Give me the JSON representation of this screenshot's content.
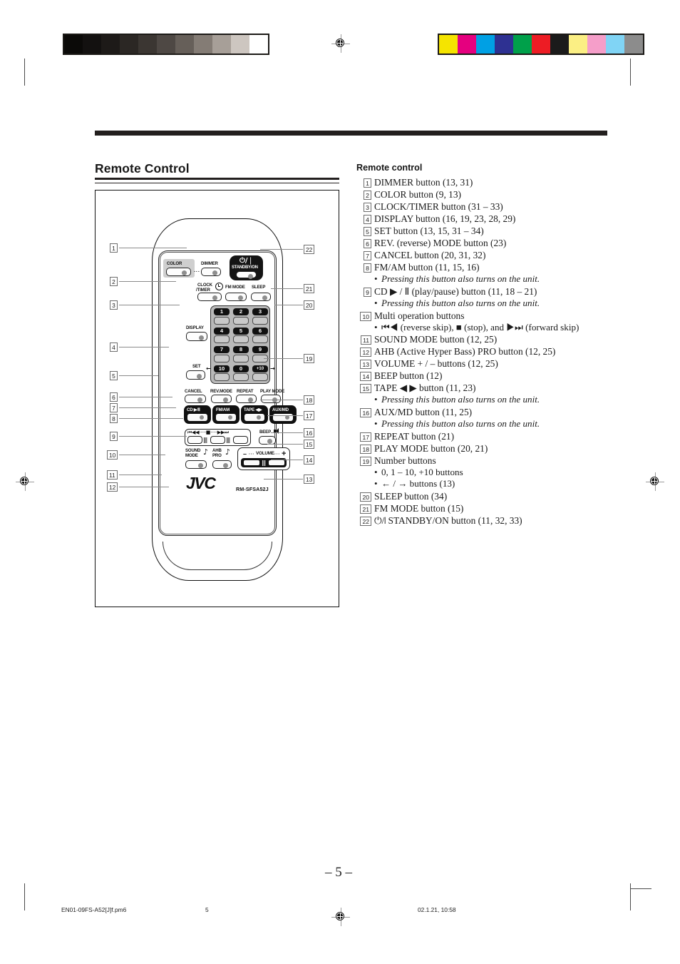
{
  "document": {
    "section_title": "Remote Control",
    "page_number": "– 5 –"
  },
  "list_header": "Remote control",
  "items": [
    {
      "n": "1",
      "text": "DIMMER button (13, 31)"
    },
    {
      "n": "2",
      "text": "COLOR button (9, 13)"
    },
    {
      "n": "3",
      "text": "CLOCK/TIMER button (31 – 33)"
    },
    {
      "n": "4",
      "text": "DISPLAY button (16, 19, 23, 28, 29)"
    },
    {
      "n": "5",
      "text": "SET button (13, 15, 31 – 34)"
    },
    {
      "n": "6",
      "text": "REV. (reverse) MODE button (23)"
    },
    {
      "n": "7",
      "text": "CANCEL button (20, 31, 32)"
    },
    {
      "n": "8",
      "text": "FM/AM button (11, 15, 16)",
      "notes": [
        {
          "style": "italic",
          "text": "Pressing this button also turns on the unit."
        }
      ]
    },
    {
      "n": "9",
      "text": "CD ▶ / Ⅱ (play/pause) button (11, 18 – 21)",
      "html": true,
      "notes": [
        {
          "style": "italic",
          "text": "Pressing this button also turns on the unit."
        }
      ]
    },
    {
      "n": "10",
      "text": "Multi operation buttons",
      "notes": [
        {
          "style": "normal",
          "text": "⏮◀ (reverse skip), ■ (stop), and ▶⏭ (forward skip)"
        }
      ]
    },
    {
      "n": "11",
      "text": "SOUND MODE button (12, 25)"
    },
    {
      "n": "12",
      "text": "AHB (Active Hyper Bass) PRO button (12, 25)"
    },
    {
      "n": "13",
      "text": "VOLUME + / – buttons (12, 25)"
    },
    {
      "n": "14",
      "text": "BEEP button (12)"
    },
    {
      "n": "15",
      "text": "TAPE ◀ ▶ button (11, 23)",
      "notes": [
        {
          "style": "italic",
          "text": "Pressing this button also turns on the unit."
        }
      ]
    },
    {
      "n": "16",
      "text": "AUX/MD button (11, 25)",
      "notes": [
        {
          "style": "italic",
          "text": "Pressing this button also turns on the unit."
        }
      ]
    },
    {
      "n": "17",
      "text": "REPEAT button (21)"
    },
    {
      "n": "18",
      "text": "PLAY MODE button (20, 21)"
    },
    {
      "n": "19",
      "text": "Number buttons",
      "notes": [
        {
          "style": "normal",
          "text": "0, 1 – 10, +10 buttons"
        },
        {
          "style": "normal",
          "text": "← / → buttons (13)"
        }
      ]
    },
    {
      "n": "20",
      "text": "SLEEP button (34)"
    },
    {
      "n": "21",
      "text": "FM MODE button (15)"
    },
    {
      "n": "22",
      "text": "⏻/❘ STANDBY/ON button (11, 32, 33)"
    }
  ],
  "remote": {
    "brand": "JVC",
    "model": "RM-SFSA52J",
    "buttons": {
      "color": "COLOR",
      "dimmer": "DIMMER",
      "clock_timer_l1": "CLOCK",
      "clock_timer_l2": "/TIMER",
      "fm_mode": "FM MODE",
      "sleep": "SLEEP",
      "display": "DISPLAY",
      "set": "SET",
      "cancel": "CANCEL",
      "rev_mode": "REV.MODE",
      "repeat": "REPEAT",
      "play_mode": "PLAY MODE",
      "beep": "BEEP",
      "sound_mode_l1": "SOUND",
      "sound_mode_l2": "MODE",
      "ahb_l1": "AHB",
      "ahb_l2": "PRO",
      "standby_power": "⏻/❘",
      "standby_label": "STANDBY/ON",
      "volume": "VOLUME",
      "volume_minus": "–",
      "volume_plus": "+",
      "cd": "CD ▶/Ⅱ",
      "fm_am": "FM/AM",
      "tape": "TAPE ◀▶",
      "aux_md": "AUX/MD"
    },
    "keypad": [
      "1",
      "2",
      "3",
      "4",
      "5",
      "6",
      "7",
      "8",
      "9",
      "10",
      "0",
      "+10"
    ],
    "multi_track": "⏮◀◀·····■·····▶▶⏭"
  },
  "callouts_left": [
    "1",
    "2",
    "3",
    "4",
    "5",
    "6",
    "7",
    "8",
    "9",
    "10",
    "11",
    "12"
  ],
  "callouts_right": [
    "22",
    "21",
    "20",
    "19",
    "18",
    "17",
    "16",
    "15",
    "14",
    "13"
  ],
  "footer": {
    "filename": "EN01-09FS-A52[J]f.pm6",
    "page": "5",
    "timestamp": "02.1.21, 10:58"
  },
  "colors": {
    "ink": "#231f1e",
    "swatches_gray": [
      "#0b0a08",
      "#131110",
      "#1d1a18",
      "#2b2724",
      "#3b3632",
      "#4e4844",
      "#665f59",
      "#847c75",
      "#a79f98",
      "#cdc6c0",
      "#ffffff"
    ],
    "swatches_color": [
      "#f5e400",
      "#e5007f",
      "#00a0e4",
      "#2e3192",
      "#00a04a",
      "#ed1c24",
      "#1b1b1b",
      "#fbef84",
      "#f59ec9",
      "#80d4f5",
      "#8c8c8c"
    ]
  }
}
